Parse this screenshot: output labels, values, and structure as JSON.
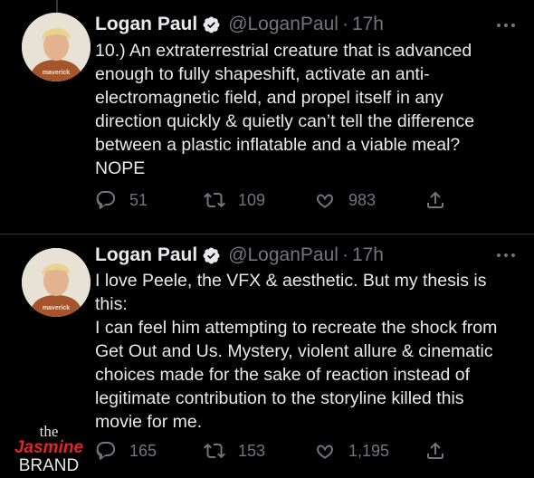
{
  "tweets": [
    {
      "author": {
        "name": "Logan Paul",
        "handle": "@LoganPaul",
        "time": "17h"
      },
      "dot": "·",
      "lines": [
        "10.) An extraterrestrial creature that is advanced",
        "enough to fully shapeshift, activate an anti-",
        "electromagnetic field, and propel itself in any",
        "direction quickly & quietly can’t tell the difference",
        "between a plastic inflatable and a viable meal?",
        "NOPE"
      ],
      "stats": {
        "replies": "51",
        "retweets": "109",
        "likes": "983"
      }
    },
    {
      "author": {
        "name": "Logan Paul",
        "handle": "@LoganPaul",
        "time": "17h"
      },
      "dot": "·",
      "lines": [
        "I love Peele, the VFX & aesthetic. But my thesis is",
        "this:",
        "I can feel him attempting to recreate the shock from",
        "Get Out and Us. Mystery, violent allure & cinematic",
        "choices made for the sake of reaction instead of",
        "legitimate contribution to the storyline killed this",
        "movie for me."
      ],
      "stats": {
        "replies": "165",
        "retweets": "153",
        "likes": "1,195"
      }
    }
  ],
  "avatar_badge": "maverick",
  "watermark": {
    "top": "the",
    "middle": "Jasmine",
    "bottom": "BRAND"
  },
  "icons": [
    "verified-badge-icon",
    "more-options-icon",
    "reply-icon",
    "retweet-icon",
    "like-icon",
    "share-icon"
  ],
  "colors": {
    "background": "#000000",
    "text": "#e7e9ea",
    "muted": "#71767b",
    "divider": "#2f3336",
    "verified": "#e7e9ea",
    "watermark_red": "#e0262c"
  }
}
